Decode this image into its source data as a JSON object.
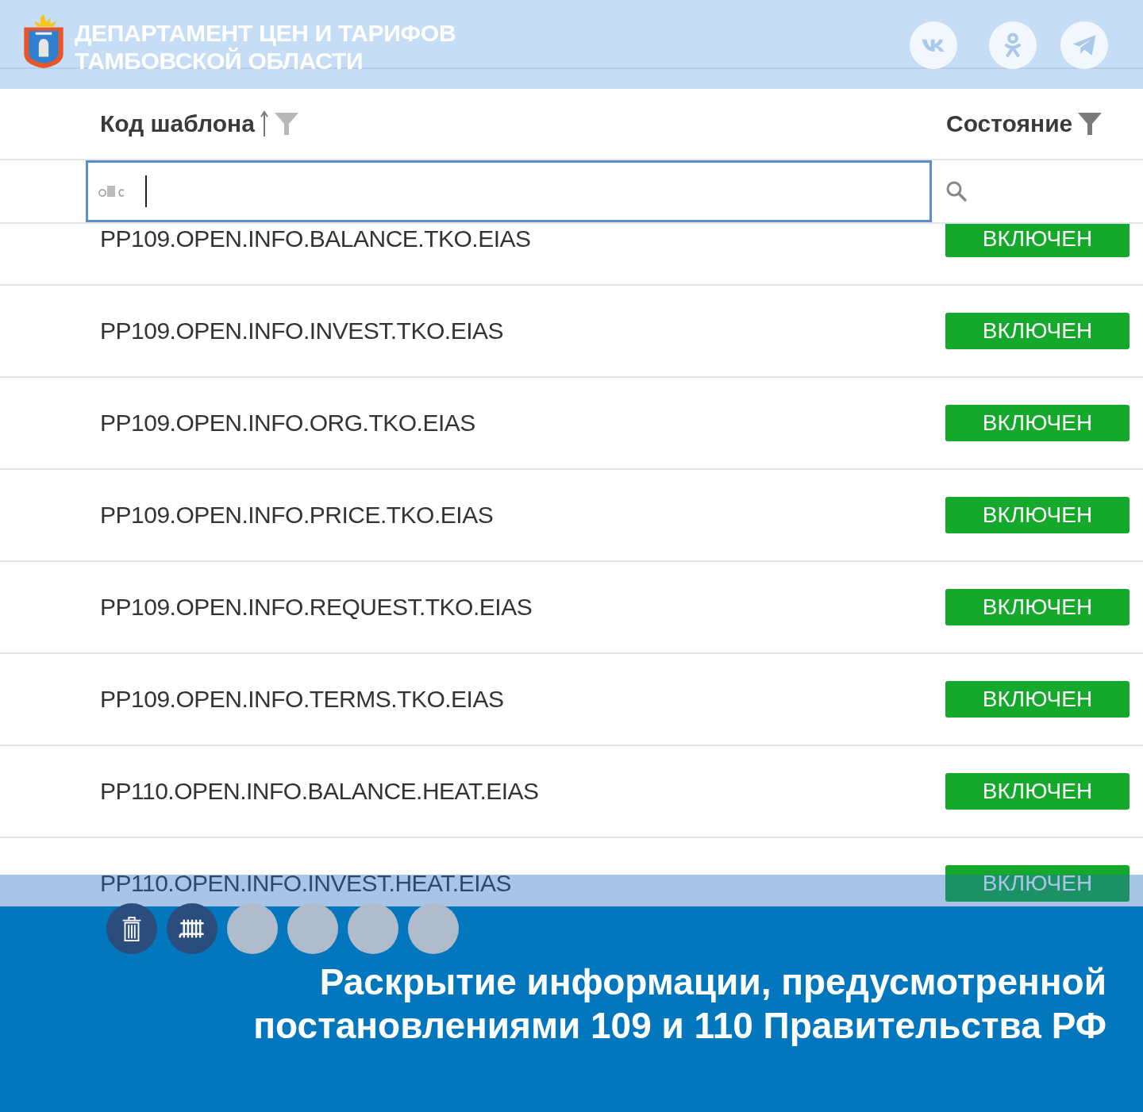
{
  "header": {
    "title_lines": [
      "ДЕПАРТАМЕНТ ЦЕН И ТАРИФОВ",
      "ТАМБОВСКОЙ ОБЛАСТИ"
    ],
    "social": [
      {
        "kind": "vk"
      },
      {
        "kind": "ok"
      },
      {
        "kind": "telegram"
      }
    ]
  },
  "table": {
    "columns": [
      {
        "label": "Код шаблона",
        "sorted": true
      },
      {
        "label": "Состояние"
      }
    ],
    "rows": [
      {
        "code": "PP109.OPEN.INFO.BALANCE.TKO.EIAS",
        "status": "ВКЛЮЧЕН"
      },
      {
        "code": "PP109.OPEN.INFO.INVEST.TKO.EIAS",
        "status": "ВКЛЮЧЕН"
      },
      {
        "code": "PP109.OPEN.INFO.ORG.TKO.EIAS",
        "status": "ВКЛЮЧЕН"
      },
      {
        "code": "PP109.OPEN.INFO.PRICE.TKO.EIAS",
        "status": "ВКЛЮЧЕН"
      },
      {
        "code": "PP109.OPEN.INFO.REQUEST.TKO.EIAS",
        "status": "ВКЛЮЧЕН"
      },
      {
        "code": "PP109.OPEN.INFO.TERMS.TKO.EIAS",
        "status": "ВКЛЮЧЕН"
      },
      {
        "code": "PP110.OPEN.INFO.BALANCE.HEAT.EIAS",
        "status": "ВКЛЮЧЕН"
      },
      {
        "code": "PP110.OPEN.INFO.INVEST.HEAT.EIAS",
        "status": "ВКЛЮЧЕН"
      }
    ]
  },
  "badges": [
    {
      "kind": "trash"
    },
    {
      "kind": "radiator"
    },
    {
      "kind": "blank"
    },
    {
      "kind": "blank"
    },
    {
      "kind": "blank"
    },
    {
      "kind": "blank"
    }
  ],
  "caption_lines": [
    "Раскрытие информации, предусмотренной",
    "постановлениями 109 и 110 Правительства РФ"
  ]
}
